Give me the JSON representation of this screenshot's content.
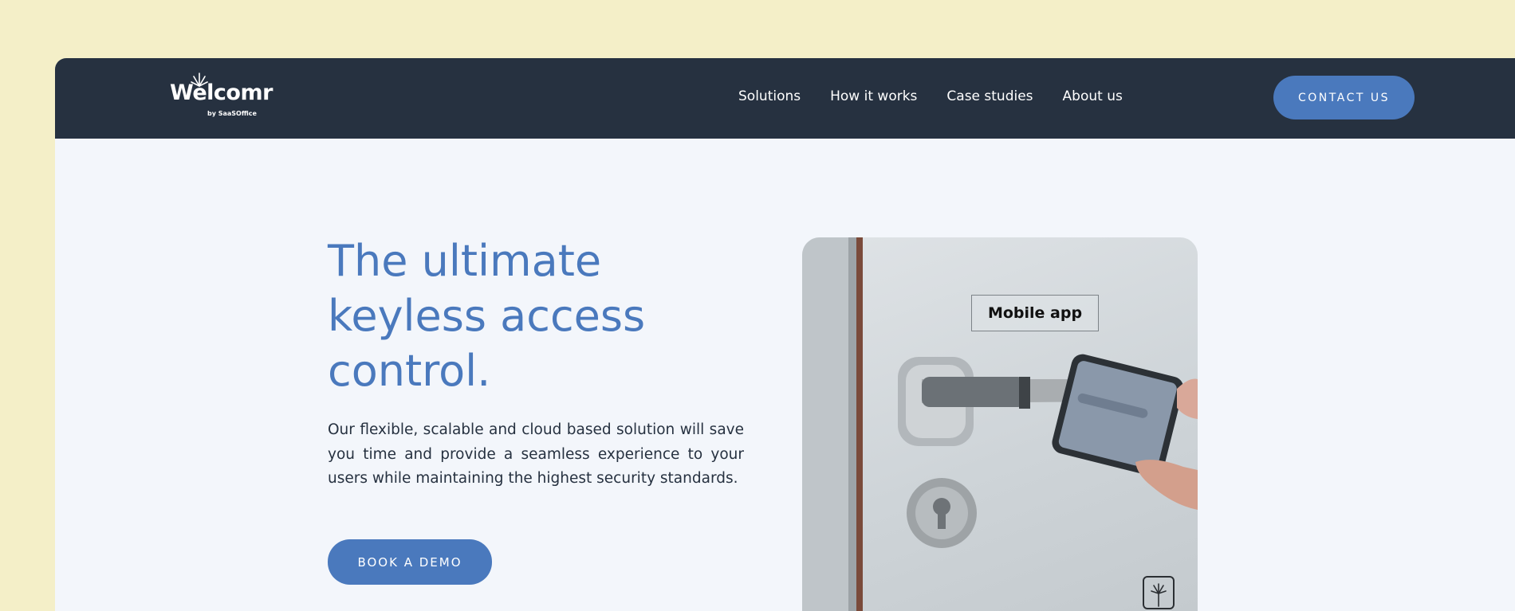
{
  "header": {
    "logo": {
      "wordmark": "Welcomr",
      "byline": "by SaaSOffice"
    },
    "nav": [
      {
        "label": "Solutions"
      },
      {
        "label": "How it works"
      },
      {
        "label": "Case studies"
      },
      {
        "label": "About us"
      }
    ],
    "contact_label": "CONTACT US"
  },
  "hero": {
    "headline": "The ultimate keyless access control.",
    "lede": "Our flexible, scalable and cloud based solution will save you time and provide a seamless experience to your users while maintaining the highest security standards.",
    "demo_label": "BOOK A DEMO"
  },
  "photo": {
    "label": "Mobile app",
    "icon": "welcomr-app-icon"
  },
  "colors": {
    "page_background": "#f4efc8",
    "nav_background": "#263140",
    "accent": "#4a79bd",
    "content_background": "#f3f6fb"
  }
}
